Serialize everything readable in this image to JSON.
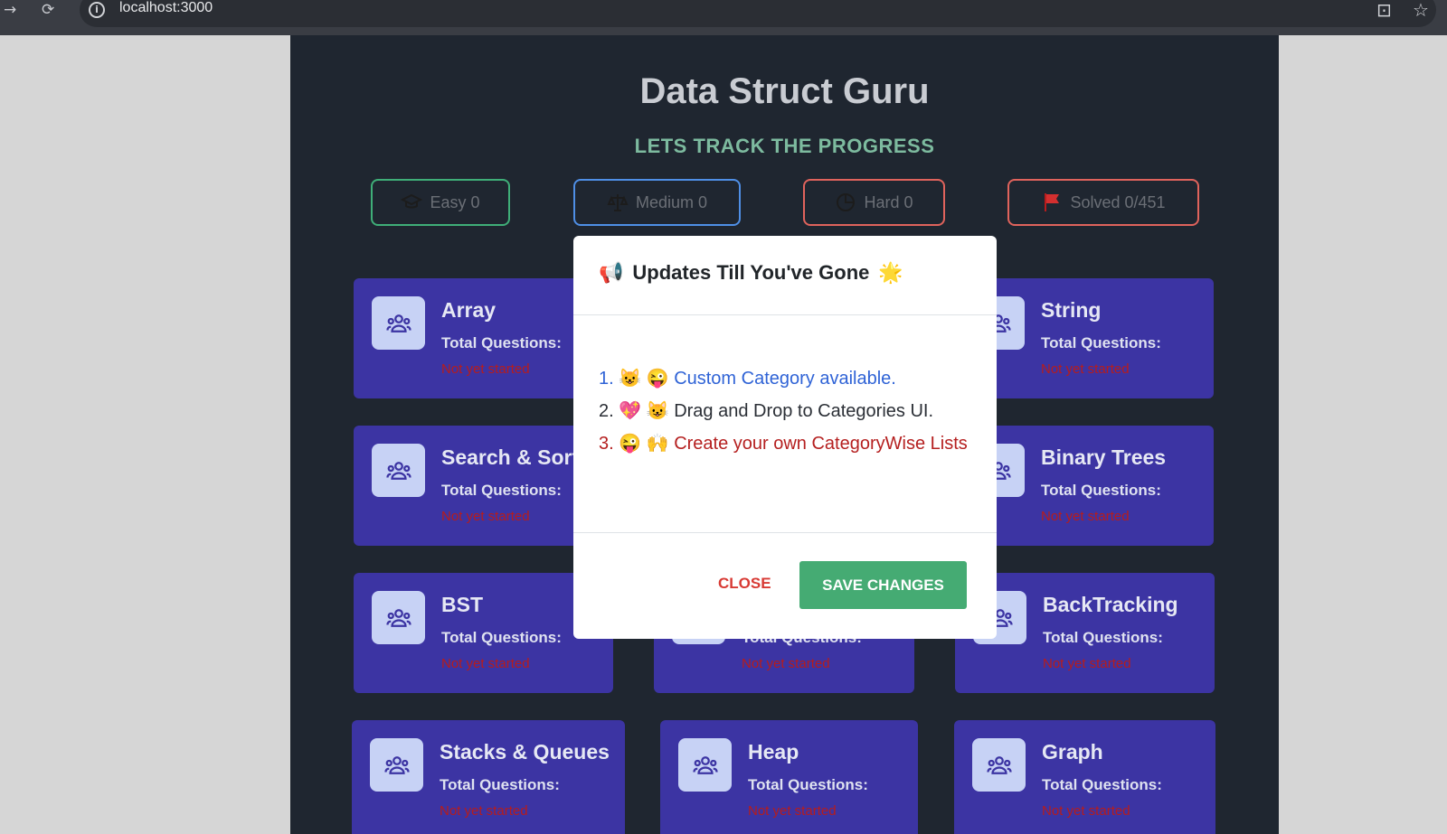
{
  "browser": {
    "url": "localhost:3000",
    "back_icon": "arrow-right-icon",
    "reload_icon": "reload-icon"
  },
  "header": {
    "title": "Data Struct Guru",
    "subtitle": "LETS TRACK THE PROGRESS"
  },
  "stats": {
    "easy": "Easy 0",
    "medium": "Medium 0",
    "hard": "Hard 0",
    "solved": "Solved 0/451"
  },
  "cards": [
    {
      "title": "Array",
      "total": "Total Questions:",
      "status": "Not yet started"
    },
    {
      "title": "String",
      "total": "Total Questions:",
      "status": "Not yet started"
    },
    {
      "title": "Search & Sort",
      "total": "Total Questions:",
      "status": "Not yet started"
    },
    {
      "title": "Binary Trees",
      "total": "Total Questions:",
      "status": "Not yet started"
    },
    {
      "title": "BST",
      "total": "Total Questions:",
      "status": "Not yet started"
    },
    {
      "title": "",
      "total": "Total Questions:",
      "status": "Not yet started"
    },
    {
      "title": "BackTracking",
      "total": "Total Questions:",
      "status": "Not yet started"
    },
    {
      "title": "Stacks & Queues",
      "total": "Total Questions:",
      "status": "Not yet started"
    },
    {
      "title": "Heap",
      "total": "Total Questions:",
      "status": "Not yet started"
    },
    {
      "title": "Graph",
      "total": "Total Questions:",
      "status": "Not yet started"
    }
  ],
  "modal": {
    "title": "Updates Till You've Gone",
    "items": [
      {
        "number": "1.",
        "emoji": "😺 😜",
        "text": "Custom Category available."
      },
      {
        "number": "2.",
        "emoji": "💖 😺",
        "text": "Drag and Drop to Categories UI."
      },
      {
        "number": "3.",
        "emoji": "😜 🙌",
        "text": "Create your own CategoryWise Lists"
      }
    ],
    "close_label": "CLOSE",
    "save_label": "SAVE CHANGES"
  },
  "colors": {
    "page_bg": "#1f2630",
    "card_bg": "#3c34a3",
    "easy": "#3fae78",
    "medium": "#4f8fe6",
    "hard": "#e0635c",
    "save": "#45ab73"
  }
}
